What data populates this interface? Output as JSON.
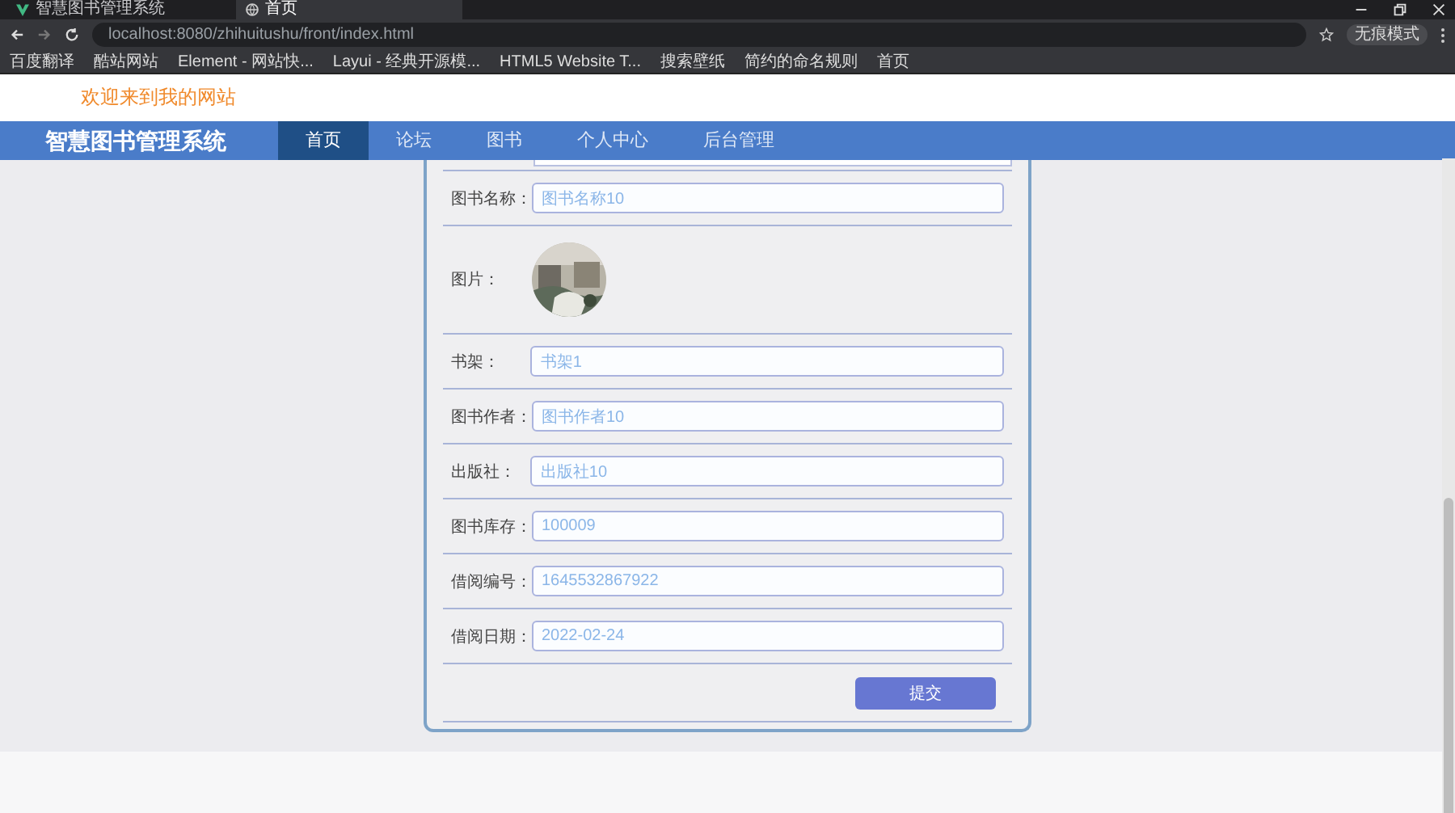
{
  "browser": {
    "tabs": [
      {
        "title": "智慧图书管理系统",
        "selected": false
      },
      {
        "title": "首页",
        "selected": true
      }
    ],
    "address": "localhost:8080/zhihuitushu/front/index.html",
    "profile": "无痕模式",
    "bookmarks": [
      "百度翻译",
      "酷站网站",
      "Element - 网站快...",
      "Layui - 经典开源模...",
      "HTML5 Website T...",
      "搜索壁纸",
      "简约的命名规则",
      "首页"
    ]
  },
  "header": {
    "welcome": "欢迎来到我的网站"
  },
  "nav": {
    "brand": "智慧图书管理系统",
    "items": [
      {
        "label": "首页",
        "selected": true
      },
      {
        "label": "论坛",
        "selected": false
      },
      {
        "label": "图书",
        "selected": false
      },
      {
        "label": "个人中心",
        "selected": false
      },
      {
        "label": "后台管理",
        "selected": false
      }
    ]
  },
  "form": {
    "fields": [
      {
        "kind": "input",
        "label": "图书名称：",
        "value": "图书名称10"
      },
      {
        "label": "图片："
      },
      {
        "kind": "input",
        "label": "书架：",
        "value": "书架1"
      },
      {
        "kind": "input",
        "label": "图书作者：",
        "value": "图书作者10"
      },
      {
        "kind": "input",
        "label": "出版社：",
        "value": "出版社10"
      },
      {
        "kind": "input",
        "label": "图书库存：",
        "value": "100009"
      },
      {
        "kind": "input",
        "label": "借阅编号：",
        "value": "1645532867922"
      },
      {
        "kind": "input",
        "label": "借阅日期：",
        "value": "2022-02-24"
      }
    ],
    "submit": "提交"
  }
}
